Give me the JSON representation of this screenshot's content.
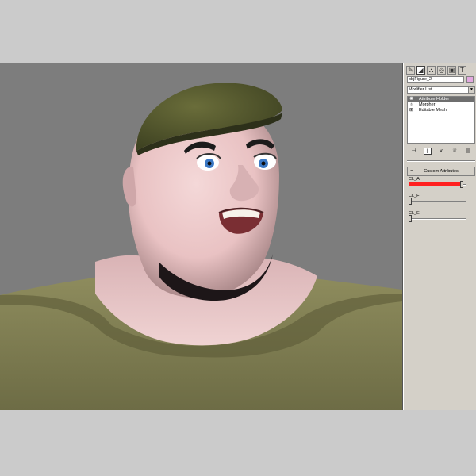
{
  "command_panel": {
    "tabs": [
      {
        "name": "create-tab-icon",
        "glyph": "✎"
      },
      {
        "name": "modify-tab-icon",
        "glyph": "◢"
      },
      {
        "name": "hierarchy-tab-icon",
        "glyph": "⛬"
      },
      {
        "name": "motion-tab-icon",
        "glyph": "◎"
      },
      {
        "name": "display-tab-icon",
        "glyph": "▣"
      },
      {
        "name": "utilities-tab-icon",
        "glyph": "T"
      }
    ],
    "object_name": "objFigure_2",
    "object_color": "#e3a9e0",
    "modifier_list_label": "Modifier List",
    "modifier_stack": [
      {
        "label": "Attribute Holder",
        "icon": "bulb-icon",
        "selected": true
      },
      {
        "label": "Morpher",
        "icon": "bulb-icon",
        "selected": false
      },
      {
        "label": "Editable Mesh",
        "icon": "plus-box-icon",
        "selected": false
      }
    ],
    "stack_tools": [
      "pin-stack-icon",
      "show-end-result-icon",
      "make-unique-icon",
      "remove-modifier-icon",
      "configure-sets-icon"
    ],
    "rollout_title": "Custom Attributes",
    "sliders": [
      {
        "label": "CL_A:",
        "value": 0.95
      },
      {
        "label": "CL_F:",
        "value": 0.0
      },
      {
        "label": "CL_E:",
        "value": 0.0
      }
    ],
    "accent_color": "#ff2020"
  }
}
